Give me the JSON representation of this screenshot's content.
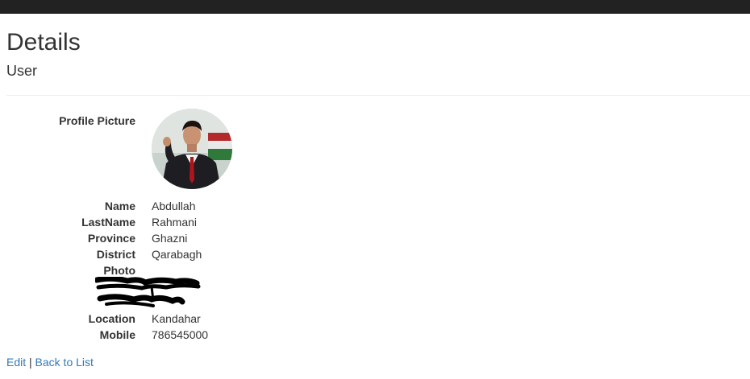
{
  "page": {
    "title": "Details",
    "subtitle": "User"
  },
  "fields": {
    "profile_picture_label": "Profile Picture",
    "name_label": "Name",
    "name_value": "Abdullah",
    "lastname_label": "LastName",
    "lastname_value": "Rahmani",
    "province_label": "Province",
    "province_value": "Ghazni",
    "district_label": "District",
    "district_value": "Qarabagh",
    "photo_label": "Photo",
    "location_label": "Location",
    "location_value": "Kandahar",
    "mobile_label": "Mobile",
    "mobile_value": "786545000"
  },
  "actions": {
    "edit_label": "Edit",
    "separator": "|",
    "back_label": "Back to List"
  },
  "colors": {
    "navbar": "#222222",
    "link": "#337ab7",
    "text": "#333333",
    "redaction": "#000000"
  },
  "icons": {
    "avatar": "profile-photo",
    "photo": "redacted-scribble"
  }
}
